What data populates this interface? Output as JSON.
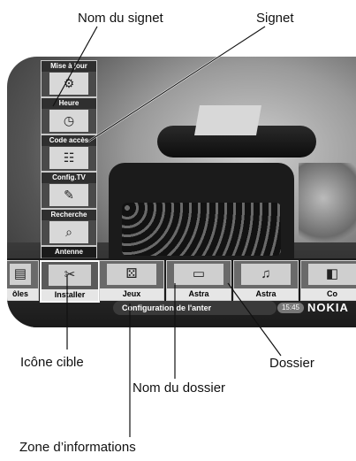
{
  "callouts": {
    "bookmark_name": "Nom du signet",
    "bookmark": "Signet",
    "target_icon": "Icône cible",
    "folder": "Dossier",
    "folder_name": "Nom du dossier",
    "info_zone": "Zone d’informations"
  },
  "bookmarks": [
    {
      "label": "Mise à jour",
      "icon": "update-icon"
    },
    {
      "label": "Heure",
      "icon": "clock-icon"
    },
    {
      "label": "Code accès",
      "icon": "access-code-icon"
    },
    {
      "label": "Config.TV",
      "icon": "tv-config-icon"
    },
    {
      "label": "Recherche",
      "icon": "search-icon"
    },
    {
      "label": "Antenne",
      "icon": "antenna-icon"
    }
  ],
  "folders": [
    {
      "label": "ôles",
      "icon": "controls-icon"
    },
    {
      "label": "Installer",
      "icon": "install-icon"
    },
    {
      "label": "Jeux",
      "icon": "dice-icon"
    },
    {
      "label": "Astra",
      "icon": "tv-icon"
    },
    {
      "label": "Astra",
      "icon": "radio-icon"
    },
    {
      "label": "Co",
      "icon": "folder-icon"
    }
  ],
  "info_bar": {
    "text": "Configuration de l'anter",
    "time": "15:45",
    "brand": "NOKIA"
  }
}
